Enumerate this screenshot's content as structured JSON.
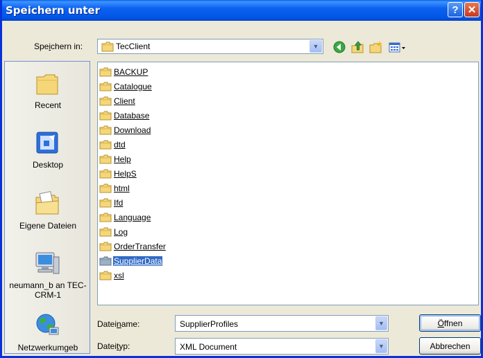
{
  "window": {
    "title": "Speichern unter",
    "help_glyph": "?",
    "close_glyph": "✕"
  },
  "toolbar": {
    "savein_label_pre": "Spe",
    "savein_label_key": "i",
    "savein_label_post": "chern in:",
    "savein_value": "TecClient",
    "icons": [
      "back-icon",
      "up-folder-icon",
      "new-folder-icon",
      "views-menu-icon"
    ]
  },
  "places": [
    {
      "label": "Recent",
      "icon": "recent-folder-icon"
    },
    {
      "label": "Desktop",
      "icon": "desktop-icon"
    },
    {
      "label": "Eigene Dateien",
      "icon": "my-documents-icon"
    },
    {
      "label": "neumann_b an TEC-CRM-1",
      "icon": "my-computer-icon"
    },
    {
      "label": "Netzwerkumgeb",
      "icon": "network-icon"
    }
  ],
  "folders": [
    "BACKUP",
    "Catalogue",
    "Client",
    "Database",
    "Download",
    "dtd",
    "Help",
    "HelpS",
    "html",
    "Ifd",
    "Language",
    "Log",
    "OrderTransfer",
    "SupplierData",
    "xsl"
  ],
  "selected_folder": "SupplierData",
  "filename": {
    "label_pre": "Datei",
    "label_key": "n",
    "label_post": "ame:",
    "value": "SupplierProfiles"
  },
  "filetype": {
    "label_pre": "Datei",
    "label_key": "t",
    "label_post": "yp:",
    "value": "XML Document"
  },
  "buttons": {
    "open_key": "Ö",
    "open_rest": "ffnen",
    "cancel": "Abbrechen"
  }
}
